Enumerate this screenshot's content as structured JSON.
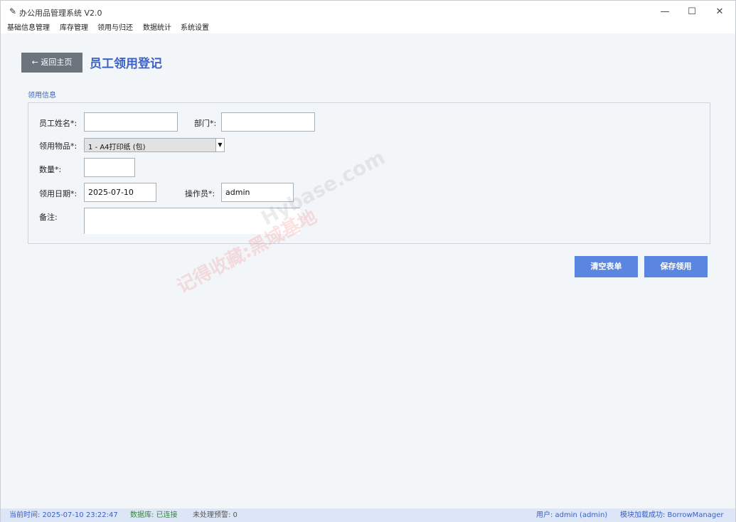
{
  "window": {
    "title": "办公用品管理系统 V2.0",
    "icon": "feather-icon"
  },
  "window_controls": {
    "minimize": "—",
    "maximize": "☐",
    "close": "✕"
  },
  "menu": [
    "基础信息管理",
    "库存管理",
    "领用与归还",
    "数据统计",
    "系统设置"
  ],
  "header": {
    "back_label": "← 返回主页",
    "page_title": "员工领用登记"
  },
  "form": {
    "group_title": "领用信息",
    "employee_name": {
      "label": "员工姓名*:",
      "value": ""
    },
    "department": {
      "label": "部门*:",
      "value": ""
    },
    "item": {
      "label": "领用物品*:",
      "selected": "1 - A4打印纸 (包)"
    },
    "quantity": {
      "label": "数量*:",
      "value": ""
    },
    "borrow_date": {
      "label": "领用日期*:",
      "value": "2025-07-10"
    },
    "operator": {
      "label": "操作员*:",
      "value": "admin"
    },
    "remark": {
      "label": "备注:",
      "value": ""
    }
  },
  "actions": {
    "clear_label": "清空表单",
    "save_label": "保存领用"
  },
  "watermark": {
    "line1": "记得收藏:黑域基地",
    "line2": "Hybase.com"
  },
  "status": {
    "time": "当前时间: 2025-07-10 23:22:47",
    "db": "数据库: 已连接",
    "alerts": "未处理预警: 0",
    "user": "用户: admin (admin)",
    "module": "模块加载成功: BorrowManager"
  },
  "colors": {
    "accent": "#3b63c7",
    "button": "#5b86e0",
    "back_button": "#6c757d",
    "db_ok": "#2e8b3a",
    "status_blue": "#3b5fc0"
  }
}
